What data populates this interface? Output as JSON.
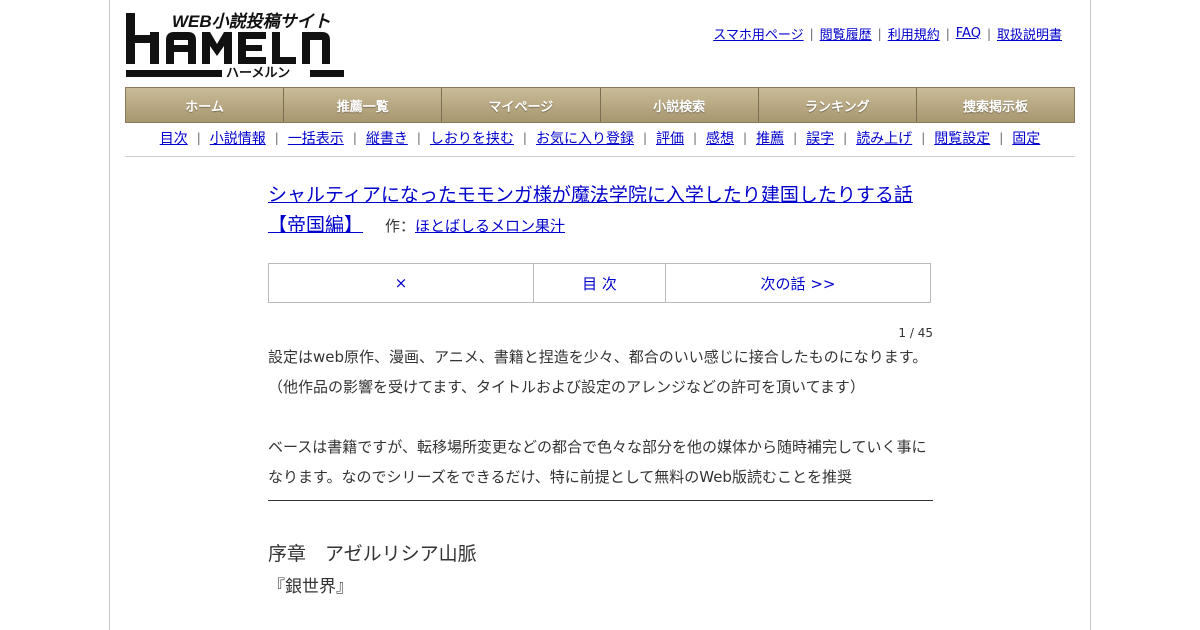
{
  "logo": {
    "tagline": "WEB小説投稿サイト",
    "name": "HAMELN",
    "kana": "ハーメルン"
  },
  "header_links": [
    "スマホ用ページ",
    "閲覧履歴",
    "利用規約",
    "FAQ",
    "取扱説明書"
  ],
  "global_nav": [
    "ホーム",
    "推薦一覧",
    "マイページ",
    "小説検索",
    "ランキング",
    "捜索掲示板"
  ],
  "sub_nav": [
    "目次",
    "小説情報",
    "一括表示",
    "縦書き",
    "しおりを挟む",
    "お気に入り登録",
    "評価",
    "感想",
    "推薦",
    "誤字",
    "読み上げ",
    "閲覧設定",
    "固定"
  ],
  "story": {
    "title": "シャルティアになったモモンガ様が魔法学院に入学したり建国したりする話【帝国編】",
    "author_prefix": "作：",
    "author": "ほとばしるメロン果汁"
  },
  "chapter_nav": {
    "close": "×",
    "toc": "目 次",
    "next": "次の話 >>"
  },
  "page_counter": "1 / 45",
  "preface": {
    "line1": "設定はweb原作、漫画、アニメ、書籍と捏造を少々、都合のいい感じに接合したものになります。",
    "line2": "（他作品の影響を受けてます、タイトルおよび設定のアレンジなどの許可を頂いてます）",
    "line3": "ベースは書籍ですが、転移場所変更などの都合で色々な部分を他の媒体から随時補完していく事になります。なのでシリーズをできるだけ、特に前提として無料のWeb版読むことを推奨"
  },
  "chapter": {
    "heading": "序章　アゼルリシア山脈",
    "subtitle": "『銀世界』"
  },
  "colors": {
    "link": "#0000cc",
    "nav_top": "#c9bb98",
    "nav_bottom": "#a89770",
    "text": "#333333"
  }
}
